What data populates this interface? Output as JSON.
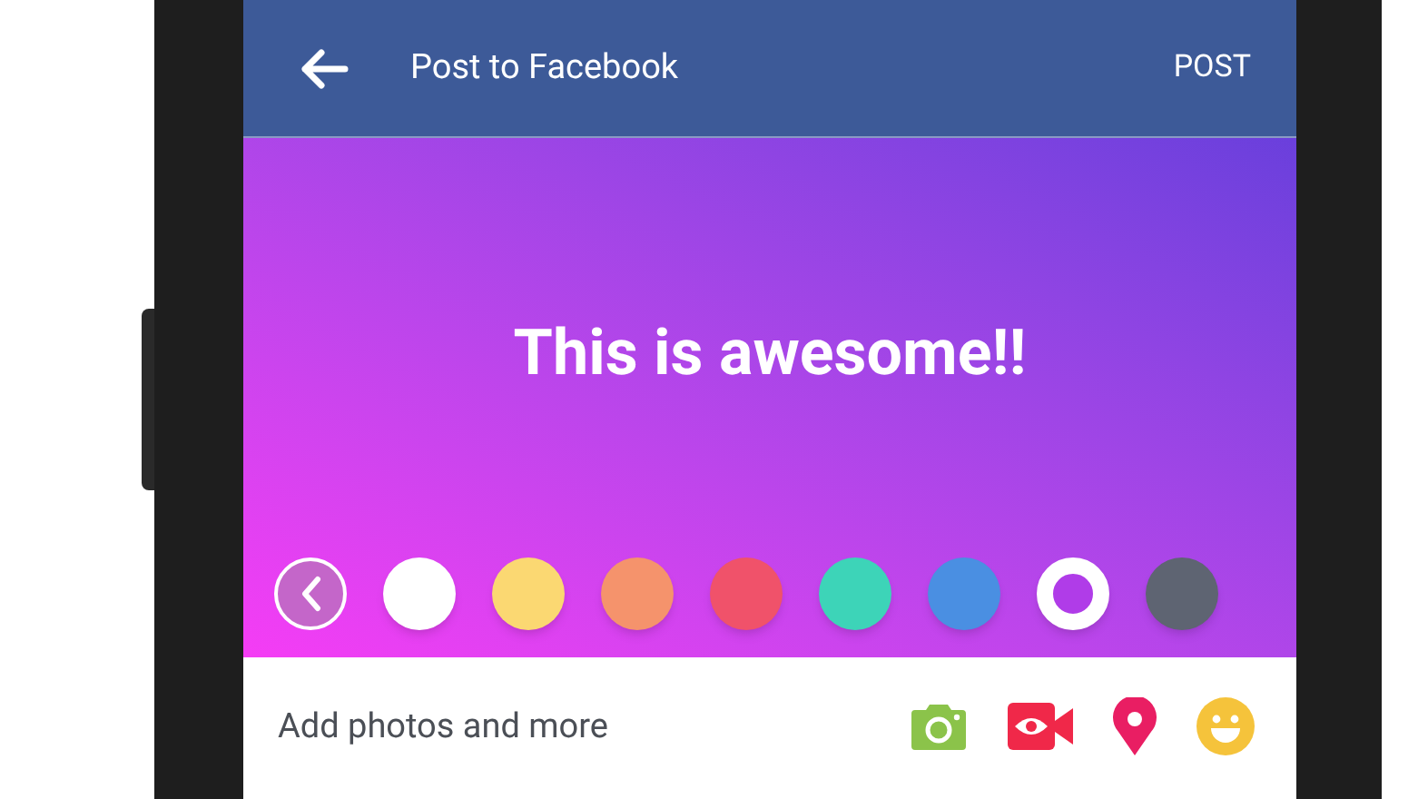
{
  "header": {
    "title": "Post to Facebook",
    "action": "POST"
  },
  "post": {
    "text": "This is awesome!!"
  },
  "swatches": [
    {
      "color": "#ffffff",
      "selected": false
    },
    {
      "color": "#fbd872",
      "selected": false
    },
    {
      "color": "#f5936c",
      "selected": false
    },
    {
      "color": "#f0526a",
      "selected": false
    },
    {
      "color": "#3dd4b8",
      "selected": false
    },
    {
      "color": "#4a8fe2",
      "selected": false
    },
    {
      "color": "#b03ce8",
      "selected": true
    },
    {
      "color": "#5e6472",
      "selected": false
    }
  ],
  "footer": {
    "label": "Add photos and more"
  }
}
